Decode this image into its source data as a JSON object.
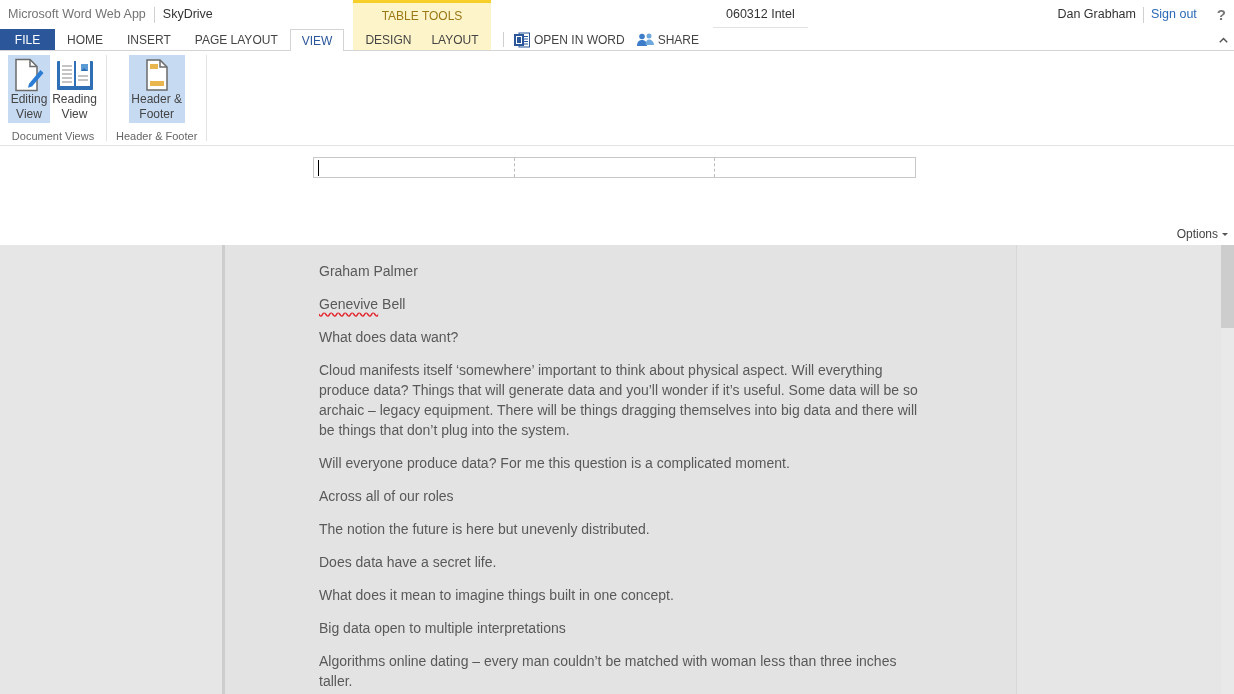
{
  "top_bar": {
    "app_name": "Microsoft Word Web App",
    "location": "SkyDrive",
    "document_title": "060312 Intel",
    "user_name": "Dan Grabham",
    "sign_out": "Sign out",
    "help": "?"
  },
  "tabs": [
    {
      "label": "FILE",
      "kind": "file",
      "selected": false
    },
    {
      "label": "HOME",
      "kind": "tab",
      "selected": false
    },
    {
      "label": "INSERT",
      "kind": "tab",
      "selected": false
    },
    {
      "label": "PAGE LAYOUT",
      "kind": "tab",
      "selected": false
    },
    {
      "label": "VIEW",
      "kind": "tab",
      "selected": true
    }
  ],
  "contextual_tabs": {
    "title": "TABLE TOOLS",
    "tabs": [
      {
        "label": "DESIGN",
        "selected": false
      },
      {
        "label": "LAYOUT",
        "selected": false
      }
    ]
  },
  "commands": [
    {
      "label": "OPEN IN WORD",
      "kind": "word"
    },
    {
      "label": "SHARE",
      "kind": "share"
    }
  ],
  "ribbon": {
    "groups": [
      {
        "label": "Document Views",
        "buttons": [
          {
            "label": "Editing View",
            "kind": "editing",
            "selected": true
          },
          {
            "label": "Reading View",
            "kind": "reading",
            "selected": false
          }
        ]
      },
      {
        "label": "Header & Footer",
        "buttons": [
          {
            "label": "Header & Footer",
            "kind": "header_footer",
            "selected": true
          }
        ]
      }
    ]
  },
  "header_table": {
    "cells": [
      {
        "caret": true
      },
      {
        "caret": false
      },
      {
        "caret": false
      }
    ]
  },
  "options": {
    "label": "Options"
  },
  "document": {
    "paragraphs": [
      {
        "runs": [
          {
            "text": "Graham Palmer",
            "misspelled": false
          }
        ]
      },
      {
        "runs": [
          {
            "text": "Genevive",
            "misspelled": true
          },
          {
            "text": " Bell",
            "misspelled": false
          }
        ]
      },
      {
        "runs": [
          {
            "text": "What does data want?",
            "misspelled": false
          }
        ]
      },
      {
        "runs": [
          {
            "text": "Cloud manifests itself ‘somewhere’ important to think about physical aspect. Will everything produce data? Things that will generate data and you’ll wonder if it’s useful. Some data will be so archaic – legacy equipment. There will be things dragging themselves into big data and there will be things that don’t plug into the system.",
            "misspelled": false
          }
        ]
      },
      {
        "runs": [
          {
            "text": "Will everyone produce data? For me this question is a complicated moment.",
            "misspelled": false
          }
        ]
      },
      {
        "runs": [
          {
            "text": "Across all of our roles",
            "misspelled": false
          }
        ]
      },
      {
        "runs": [
          {
            "text": "The notion the future is here but unevenly distributed.",
            "misspelled": false
          }
        ]
      },
      {
        "runs": [
          {
            "text": "Does data have a secret life.",
            "misspelled": false
          }
        ]
      },
      {
        "runs": [
          {
            "text": "What does it mean to imagine things built in one concept.",
            "misspelled": false
          }
        ]
      },
      {
        "runs": [
          {
            "text": "Big data open to multiple interpretations",
            "misspelled": false
          }
        ]
      },
      {
        "runs": [
          {
            "text": "Algorithms online dating – every man couldn’t be matched with woman less than three inches taller.",
            "misspelled": false
          }
        ]
      }
    ]
  }
}
